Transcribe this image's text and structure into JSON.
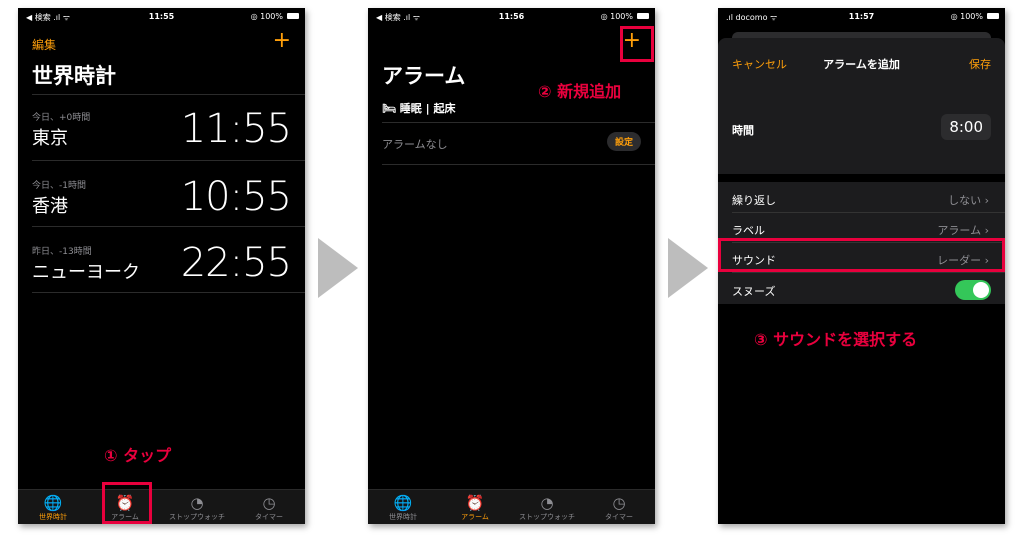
{
  "panel1": {
    "status": {
      "left": "◀ 検索 .ıl ᯤ",
      "time": "11:55",
      "right": "◎ 100%"
    },
    "edit": "編集",
    "add": "+",
    "title": "世界時計",
    "clocks": [
      {
        "sub": "今日、+0時間",
        "city": "東京",
        "time": "11:55"
      },
      {
        "sub": "今日、-1時間",
        "city": "香港",
        "time": "10:55"
      },
      {
        "sub": "昨日、-13時間",
        "city": "ニューヨーク",
        "time": "22:55"
      }
    ],
    "callout": "① タップ",
    "tabs": [
      {
        "icon": "🌐",
        "label": "世界時計"
      },
      {
        "icon": "⏰",
        "label": "アラーム"
      },
      {
        "icon": "◔",
        "label": "ストップウォッチ"
      },
      {
        "icon": "◷",
        "label": "タイマー"
      }
    ]
  },
  "panel2": {
    "status": {
      "left": "◀ 検索 .ıl ᯤ",
      "time": "11:56",
      "right": "◎ 100%"
    },
    "add": "+",
    "title": "アラーム",
    "sleep": "🛏 睡眠 | 起床",
    "no_alarm": "アラームなし",
    "setup": "設定",
    "callout": "② 新規追加",
    "tabs": [
      {
        "icon": "🌐",
        "label": "世界時計"
      },
      {
        "icon": "⏰",
        "label": "アラーム"
      },
      {
        "icon": "◔",
        "label": "ストップウォッチ"
      },
      {
        "icon": "◷",
        "label": "タイマー"
      }
    ]
  },
  "panel3": {
    "status": {
      "left": ".ıl docomo ᯤ",
      "time": "11:57",
      "right": "◎ 100%"
    },
    "cancel": "キャンセル",
    "header_title": "アラームを追加",
    "save": "保存",
    "time_label": "時間",
    "time_value": "8:00",
    "repeat_label": "繰り返し",
    "repeat_value": "しない ›",
    "label_label": "ラベル",
    "label_value": "アラーム ›",
    "sound_label": "サウンド",
    "sound_value": "レーダー ›",
    "snooze_label": "スヌーズ",
    "snooze_on": true,
    "callout": "③ サウンドを選択する"
  },
  "colors": {
    "accent": "#ff9f0a",
    "callout": "#e8003d",
    "toggle_on": "#34c759"
  }
}
